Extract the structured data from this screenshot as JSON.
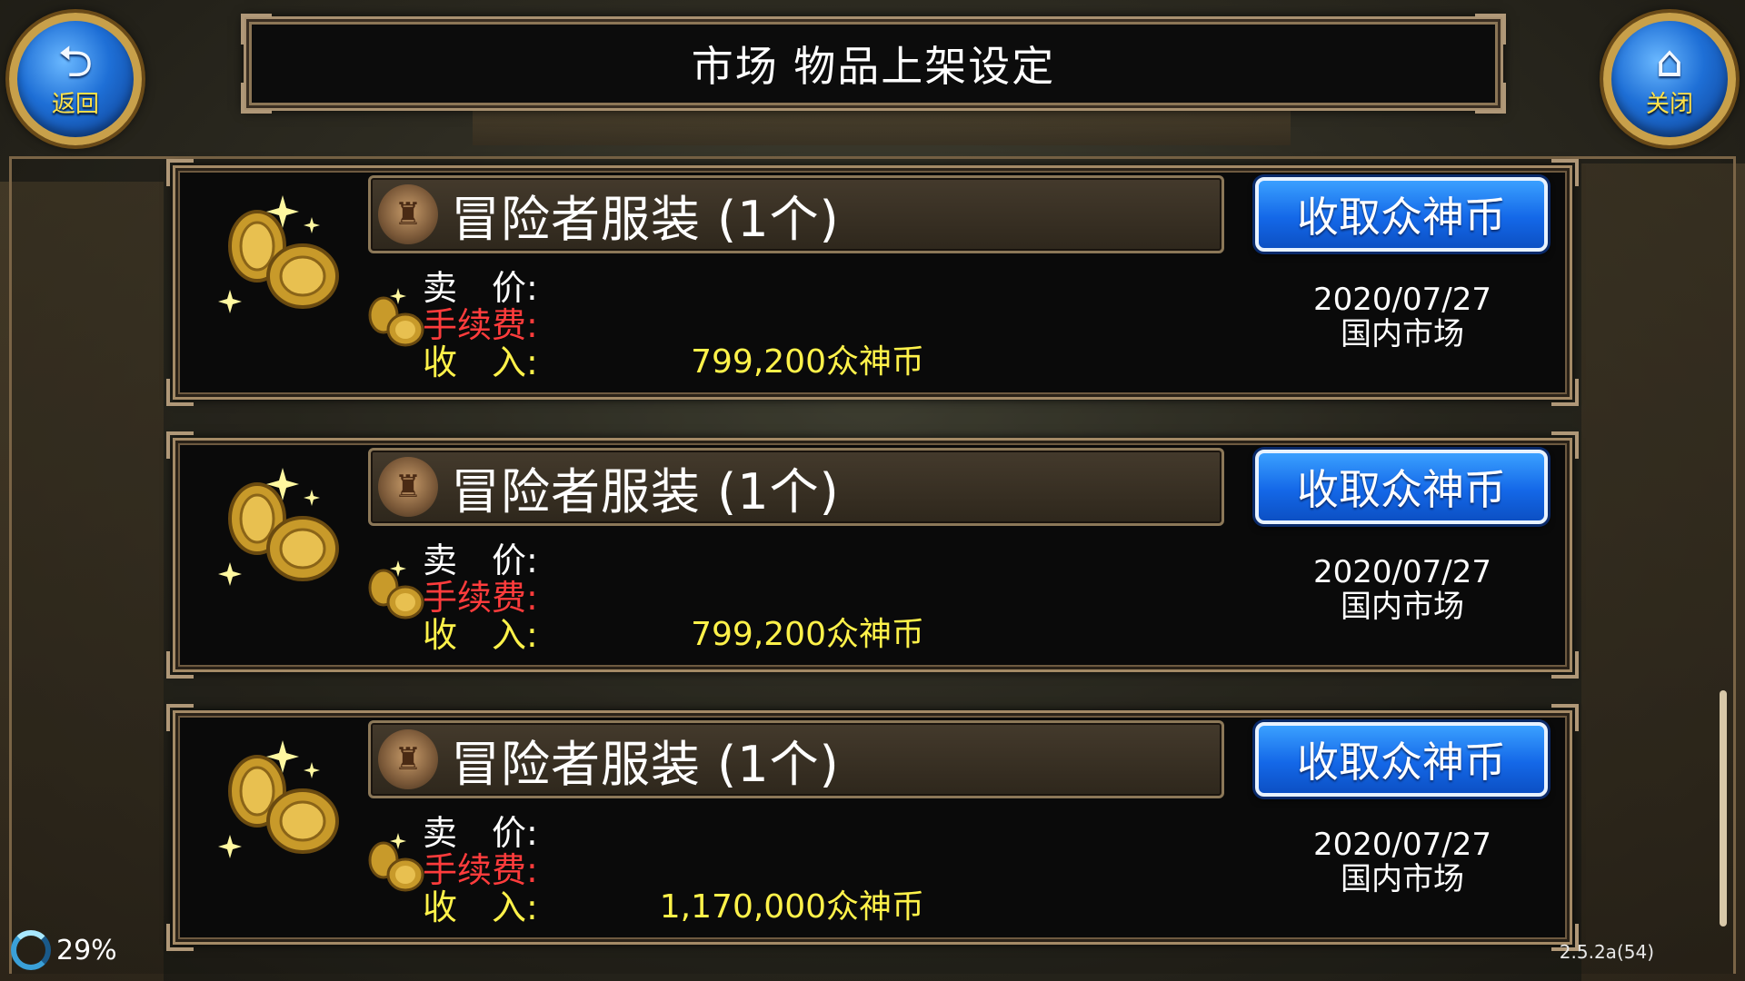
{
  "header": {
    "title": "市场 物品上架设定",
    "back_label": "返回",
    "close_label": "关闭"
  },
  "labels": {
    "price": "卖　价:",
    "fee": "手续费:",
    "income": "收　入:"
  },
  "listings": [
    {
      "item_name": "冒险者服装 (1个)",
      "claim_label": "收取众神币",
      "income": "799,200众神币",
      "date": "2020/07/27",
      "market": "国内市场"
    },
    {
      "item_name": "冒险者服装 (1个)",
      "claim_label": "收取众神币",
      "income": "799,200众神币",
      "date": "2020/07/27",
      "market": "国内市场"
    },
    {
      "item_name": "冒险者服装 (1个)",
      "claim_label": "收取众神币",
      "income": "1,170,000众神币",
      "date": "2020/07/27",
      "market": "国内市场"
    }
  ],
  "status": {
    "loading_percent": "29%",
    "version": "2.5.2a(54)"
  },
  "icons": {
    "back": "back-arrow-icon",
    "close": "home-icon",
    "coins": "coin-stack-icon",
    "item": "armor-icon",
    "loading": "spinner-icon"
  },
  "colors": {
    "fee_label": "#ff3c3c",
    "income_label": "#fff24a",
    "claim_button": "#1468e8",
    "nav_button_label": "#ffe24a"
  }
}
